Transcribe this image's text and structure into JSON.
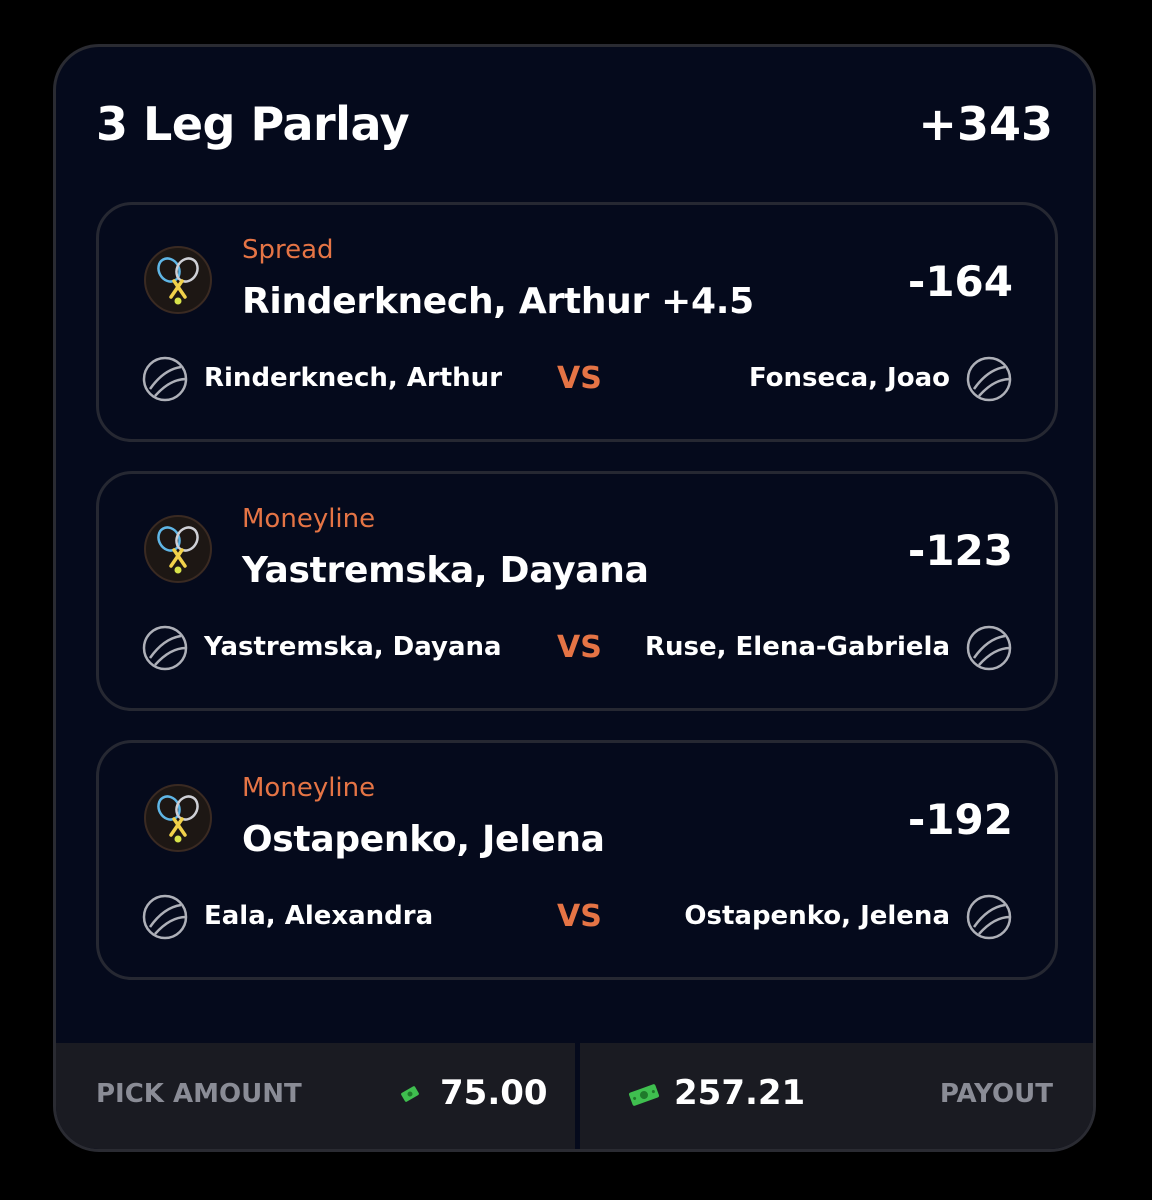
{
  "parlay": {
    "title": "3 Leg Parlay",
    "odds": "+343"
  },
  "legs": [
    {
      "market": "Spread",
      "selection": "Rinderknech, Arthur +4.5",
      "odds": "-164",
      "player_left": "Rinderknech, Arthur",
      "vs": "VS",
      "player_right": "Fonseca, Joao",
      "sport_icon": "tennis-rackets-icon",
      "player_icon": "tennis-ball-icon"
    },
    {
      "market": "Moneyline",
      "selection": "Yastremska, Dayana",
      "odds": "-123",
      "player_left": "Yastremska, Dayana",
      "vs": "VS",
      "player_right": "Ruse, Elena-Gabriela",
      "sport_icon": "tennis-rackets-icon",
      "player_icon": "tennis-ball-icon"
    },
    {
      "market": "Moneyline",
      "selection": "Ostapenko, Jelena",
      "odds": "-192",
      "player_left": "Eala, Alexandra",
      "vs": "VS",
      "player_right": "Ostapenko, Jelena",
      "sport_icon": "tennis-rackets-icon",
      "player_icon": "tennis-ball-icon"
    }
  ],
  "footer": {
    "pick_label": "PICK AMOUNT",
    "pick_value": "75.00",
    "payout_value": "257.21",
    "payout_label": "PAYOUT",
    "cash_icon": "cash-icon"
  },
  "colors": {
    "background": "#000000",
    "card": "#050a1c",
    "accent": "#e57445",
    "text": "#ffffff",
    "muted": "#8a8c96",
    "footer": "#1a1b22",
    "cash": "#3fbf4f"
  }
}
